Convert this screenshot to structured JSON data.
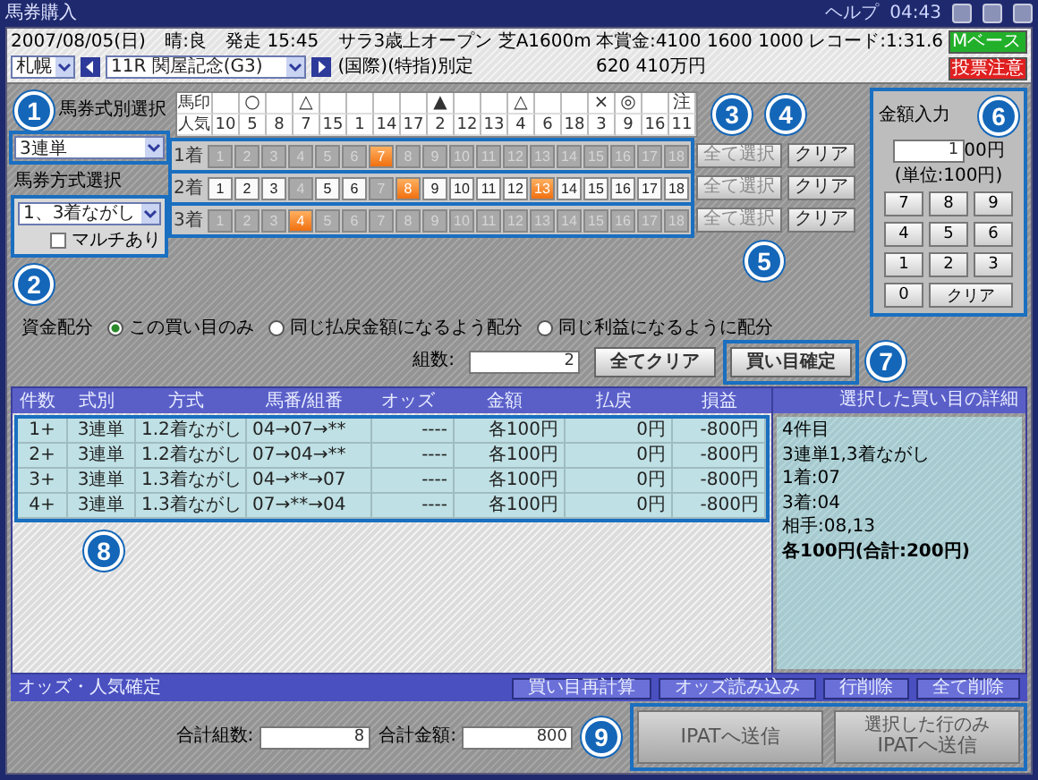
{
  "window": {
    "title": "馬券購入",
    "help": "ヘルプ",
    "time": "04:43"
  },
  "race_info": {
    "date": "2007/08/05(日)",
    "weather": "晴:良",
    "post_time": "発走 15:45",
    "race_class": "サラ3歳上オープン 芝A1600m",
    "prize": "本賞金:4100 1600 1000",
    "record": "レコード:1:31.6",
    "venue": "札幌",
    "race": "11R 関屋記念(G3)",
    "conditions": "(国際)(特指)別定",
    "prize_2": "620 410万円",
    "badges": [
      {
        "text": "Mベース",
        "color": "#22b02a"
      },
      {
        "text": "投票注意",
        "color": "#e02020"
      }
    ]
  },
  "bet_type": {
    "label": "馬券式別選択",
    "value": "3連単"
  },
  "bet_method": {
    "label": "馬券方式選択",
    "value": "1、3着ながし",
    "multi": {
      "label": "マルチあり",
      "checked": false
    }
  },
  "horse_table": {
    "mark_label": "馬印",
    "popularity_label": "人気",
    "columns": [
      {
        "popularity": "10"
      },
      {
        "mark": "○",
        "popularity": "5"
      },
      {
        "popularity": "8"
      },
      {
        "mark": "△",
        "popularity": "7"
      },
      {
        "popularity": "15"
      },
      {
        "popularity": "1"
      },
      {
        "popularity": "14"
      },
      {
        "popularity": "17"
      },
      {
        "mark": "▲",
        "popularity": "2"
      },
      {
        "popularity": "12"
      },
      {
        "popularity": "13"
      },
      {
        "mark": "△",
        "popularity": "4"
      },
      {
        "popularity": "6"
      },
      {
        "popularity": "18"
      },
      {
        "mark": "×",
        "popularity": "3"
      },
      {
        "mark": "◎",
        "popularity": "9"
      },
      {
        "popularity": "16"
      },
      {
        "mark": "注",
        "popularity": "11"
      }
    ]
  },
  "positions": [
    {
      "label": "1着",
      "select_all": {
        "text": "全て選択",
        "disabled": true
      },
      "clear": "クリア",
      "horses": [
        {
          "number": "1",
          "selected": false,
          "disabled": true
        },
        {
          "number": "2",
          "selected": false,
          "disabled": true
        },
        {
          "number": "3",
          "selected": false,
          "disabled": true
        },
        {
          "number": "4",
          "selected": false,
          "disabled": true
        },
        {
          "number": "5",
          "selected": false,
          "disabled": true
        },
        {
          "number": "6",
          "selected": false,
          "disabled": true
        },
        {
          "number": "7",
          "selected": true,
          "disabled": false
        },
        {
          "number": "8",
          "selected": false,
          "disabled": true
        },
        {
          "number": "9",
          "selected": false,
          "disabled": true
        },
        {
          "number": "10",
          "selected": false,
          "disabled": true
        },
        {
          "number": "11",
          "selected": false,
          "disabled": true
        },
        {
          "number": "12",
          "selected": false,
          "disabled": true
        },
        {
          "number": "13",
          "selected": false,
          "disabled": true
        },
        {
          "number": "14",
          "selected": false,
          "disabled": true
        },
        {
          "number": "15",
          "selected": false,
          "disabled": true
        },
        {
          "number": "16",
          "selected": false,
          "disabled": true
        },
        {
          "number": "17",
          "selected": false,
          "disabled": true
        },
        {
          "number": "18",
          "selected": false,
          "disabled": true
        }
      ]
    },
    {
      "label": "2着",
      "select_all": {
        "text": "全て選択",
        "disabled": true
      },
      "clear": "クリア",
      "horses": [
        {
          "number": "1",
          "selected": false,
          "disabled": false
        },
        {
          "number": "2",
          "selected": false,
          "disabled": false
        },
        {
          "number": "3",
          "selected": false,
          "disabled": false
        },
        {
          "number": "4",
          "selected": false,
          "disabled": true
        },
        {
          "number": "5",
          "selected": false,
          "disabled": false
        },
        {
          "number": "6",
          "selected": false,
          "disabled": false
        },
        {
          "number": "7",
          "selected": false,
          "disabled": true
        },
        {
          "number": "8",
          "selected": true,
          "disabled": false
        },
        {
          "number": "9",
          "selected": false,
          "disabled": false
        },
        {
          "number": "10",
          "selected": false,
          "disabled": false
        },
        {
          "number": "11",
          "selected": false,
          "disabled": false
        },
        {
          "number": "12",
          "selected": false,
          "disabled": false
        },
        {
          "number": "13",
          "selected": true,
          "disabled": false
        },
        {
          "number": "14",
          "selected": false,
          "disabled": false
        },
        {
          "number": "15",
          "selected": false,
          "disabled": false
        },
        {
          "number": "16",
          "selected": false,
          "disabled": false
        },
        {
          "number": "17",
          "selected": false,
          "disabled": false
        },
        {
          "number": "18",
          "selected": false,
          "disabled": false
        }
      ]
    },
    {
      "label": "3着",
      "select_all": {
        "text": "全て選択",
        "disabled": true
      },
      "clear": "クリア",
      "horses": [
        {
          "number": "1",
          "selected": false,
          "disabled": true
        },
        {
          "number": "2",
          "selected": false,
          "disabled": true
        },
        {
          "number": "3",
          "selected": false,
          "disabled": true
        },
        {
          "number": "4",
          "selected": true,
          "disabled": false
        },
        {
          "number": "5",
          "selected": false,
          "disabled": true
        },
        {
          "number": "6",
          "selected": false,
          "disabled": true
        },
        {
          "number": "7",
          "selected": false,
          "disabled": true
        },
        {
          "number": "8",
          "selected": false,
          "disabled": true
        },
        {
          "number": "9",
          "selected": false,
          "disabled": true
        },
        {
          "number": "10",
          "selected": false,
          "disabled": true
        },
        {
          "number": "11",
          "selected": false,
          "disabled": true
        },
        {
          "number": "12",
          "selected": false,
          "disabled": true
        },
        {
          "number": "13",
          "selected": false,
          "disabled": true
        },
        {
          "number": "14",
          "selected": false,
          "disabled": true
        },
        {
          "number": "15",
          "selected": false,
          "disabled": true
        },
        {
          "number": "16",
          "selected": false,
          "disabled": true
        },
        {
          "number": "17",
          "selected": false,
          "disabled": true
        },
        {
          "number": "18",
          "selected": false,
          "disabled": true
        }
      ]
    }
  ],
  "allocation": {
    "label": "資金配分",
    "options": [
      {
        "label": "この買い目のみ",
        "selected": true
      },
      {
        "label": "同じ払戻金額になるよう配分",
        "selected": false
      },
      {
        "label": "同じ利益になるように配分",
        "selected": false
      }
    ]
  },
  "combos": {
    "label": "組数:",
    "value": "2"
  },
  "clear_all": "全てクリア",
  "confirm": "買い目確定",
  "amount": {
    "title": "金額入力",
    "value": "1",
    "unit": "00円",
    "note": "(単位:100円)",
    "keys": [
      "7",
      "8",
      "9",
      "4",
      "5",
      "6",
      "1",
      "2",
      "3",
      "0",
      "クリア"
    ]
  },
  "table": {
    "columns": [
      "件数",
      "式別",
      "方式",
      "馬番/組番",
      "オッズ",
      "金額",
      "払戻",
      "損益"
    ],
    "rows": [
      [
        "1+",
        "3連単",
        "1.2着ながし",
        "04→07→**",
        "----",
        "各100円",
        "0円",
        "-800円"
      ],
      [
        "2+",
        "3連単",
        "1.2着ながし",
        "07→04→**",
        "----",
        "各100円",
        "0円",
        "-800円"
      ],
      [
        "3+",
        "3連単",
        "1.3着ながし",
        "04→**→07",
        "----",
        "各100円",
        "0円",
        "-800円"
      ],
      [
        "4+",
        "3連単",
        "1.3着ながし",
        "07→**→04",
        "----",
        "各100円",
        "0円",
        "-800円"
      ]
    ]
  },
  "detail": {
    "title": "選択した買い目の詳細",
    "lines": [
      {
        "text": "4件目",
        "bold": false
      },
      {
        "text": "3連単1,3着ながし",
        "bold": false
      },
      {
        "text": "1着:07",
        "bold": false
      },
      {
        "text": "3着:04",
        "bold": false
      },
      {
        "text": "相手:08,13",
        "bold": false
      },
      {
        "text": "各100円(合計:200円)",
        "bold": true
      }
    ]
  },
  "bottom_bar": {
    "label": "オッズ・人気確定",
    "buttons": [
      "買い目再計算",
      "オッズ読み込み",
      "行削除",
      "全て削除"
    ]
  },
  "totals": [
    {
      "label": "合計組数:",
      "value": "8"
    },
    {
      "label": "合計金額:",
      "value": "800"
    }
  ],
  "send_buttons": [
    {
      "label": "IPATへ送信"
    },
    {
      "note": "選択した行のみ",
      "label": "IPATへ送信"
    }
  ],
  "annotations": [
    "1",
    "2",
    "3",
    "4",
    "5",
    "6",
    "7",
    "8",
    "9"
  ]
}
